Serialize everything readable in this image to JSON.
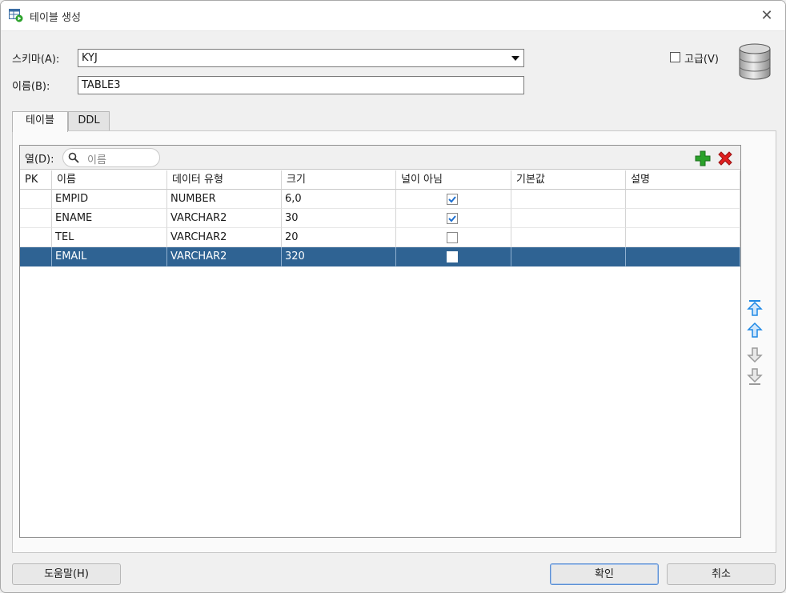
{
  "window": {
    "title": "테이블 생성",
    "close_label": "✕"
  },
  "form": {
    "schema_label": "스키마(A):",
    "schema_value": "KYJ",
    "name_label": "이름(B):",
    "name_value": "TABLE3",
    "advanced_label": "고급(V)",
    "advanced_checked": false
  },
  "tabs": [
    {
      "label": "테이블",
      "active": true
    },
    {
      "label": "DDL",
      "active": false
    }
  ],
  "columns_grid": {
    "label": "열(D):",
    "search_placeholder": "이름",
    "headers": [
      "PK",
      "이름",
      "데이터 유형",
      "크기",
      "널이 아님",
      "기본값",
      "설명"
    ],
    "rows": [
      {
        "name": "EMPID",
        "type": "NUMBER",
        "size": "6,0",
        "not_null": true,
        "selected": false
      },
      {
        "name": "ENAME",
        "type": "VARCHAR2",
        "size": "30",
        "not_null": true,
        "selected": false
      },
      {
        "name": "TEL",
        "type": "VARCHAR2",
        "size": "20",
        "not_null": false,
        "selected": false
      },
      {
        "name": "EMAIL",
        "type": "VARCHAR2",
        "size": "320",
        "not_null": false,
        "selected": true
      }
    ]
  },
  "buttons": {
    "help": "도움말(H)",
    "ok": "확인",
    "cancel": "취소"
  },
  "icons": {
    "title": "create-table-icon",
    "database": "database-icon",
    "add": "add-column-icon",
    "delete": "delete-column-icon",
    "move_top": "move-top-icon",
    "move_up": "move-up-icon",
    "move_down": "move-down-icon",
    "move_bottom": "move-bottom-icon"
  },
  "colors": {
    "selection": "#2f6393",
    "accent_blue": "#1e88e5",
    "add_green": "#2aa12a",
    "delete_red": "#e02020"
  }
}
